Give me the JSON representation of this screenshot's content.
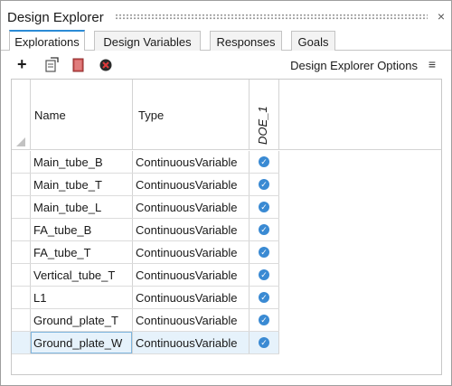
{
  "panel": {
    "title": "Design Explorer",
    "close_glyph": "×"
  },
  "tabs": [
    {
      "label": "Explorations",
      "active": true
    },
    {
      "label": "Design Variables",
      "active": false
    },
    {
      "label": "Responses",
      "active": false
    },
    {
      "label": "Goals",
      "active": false
    }
  ],
  "toolbar": {
    "icons": [
      "add-icon",
      "import-icon",
      "book-icon",
      "run-icon"
    ],
    "add_glyph": "+",
    "options_label": "Design Explorer Options",
    "menu_glyph": "≡"
  },
  "table": {
    "columns": {
      "name": "Name",
      "type": "Type",
      "doe": "DOE_1"
    },
    "rows": [
      {
        "name": "Main_tube_B",
        "type": "ContinuousVariable",
        "doe_checked": true
      },
      {
        "name": "Main_tube_T",
        "type": "ContinuousVariable",
        "doe_checked": true
      },
      {
        "name": "Main_tube_L",
        "type": "ContinuousVariable",
        "doe_checked": true
      },
      {
        "name": "FA_tube_B",
        "type": "ContinuousVariable",
        "doe_checked": true
      },
      {
        "name": "FA_tube_T",
        "type": "ContinuousVariable",
        "doe_checked": true
      },
      {
        "name": "Vertical_tube_T",
        "type": "ContinuousVariable",
        "doe_checked": true
      },
      {
        "name": "L1",
        "type": "ContinuousVariable",
        "doe_checked": true
      },
      {
        "name": "Ground_plate_T",
        "type": "ContinuousVariable",
        "doe_checked": true
      },
      {
        "name": "Ground_plate_W",
        "type": "ContinuousVariable",
        "doe_checked": true
      }
    ],
    "check_glyph": "✓"
  },
  "colors": {
    "accent": "#2b8bd6",
    "check": "#3a8ad3",
    "selected_row": "#e6f2fb"
  }
}
